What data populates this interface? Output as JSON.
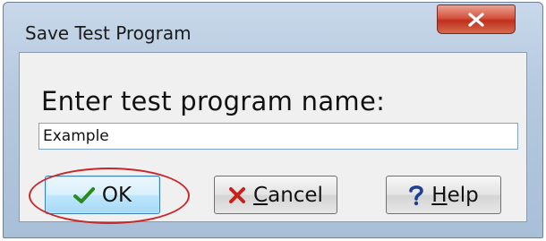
{
  "dialog": {
    "title": "Save Test Program",
    "close_label": "x",
    "prompt": "Enter test program name:",
    "input_value": "Example"
  },
  "buttons": {
    "ok": {
      "label": "OK",
      "icon": "checkmark-icon",
      "is_default": true
    },
    "cancel": {
      "accel": "C",
      "rest": "ancel",
      "icon": "x-icon"
    },
    "help": {
      "accel": "H",
      "rest": "elp",
      "icon": "question-mark-icon"
    }
  },
  "annotation": {
    "type": "red-ellipse-highlight",
    "target": "ok-button",
    "color": "#c8282a"
  },
  "colors": {
    "checkmark": "#2a8a1c",
    "cancel_x": "#c8201a",
    "help_question": "#1f3f8f"
  }
}
